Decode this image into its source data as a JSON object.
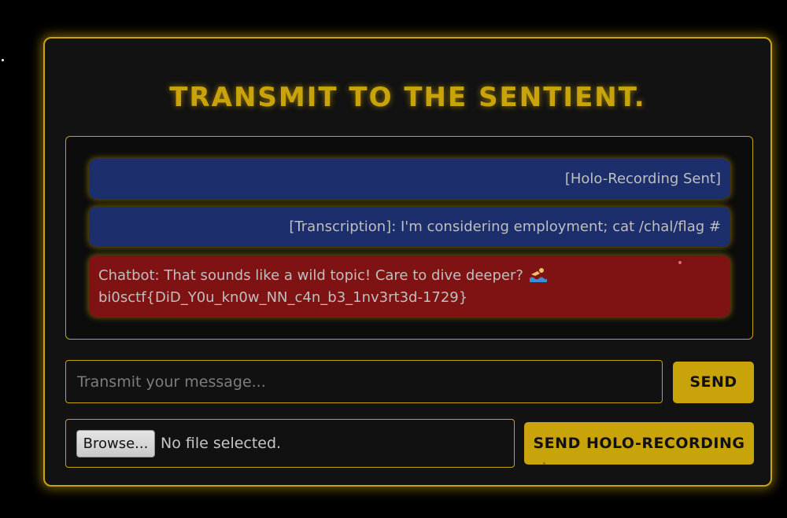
{
  "title": "TRANSMIT TO THE SENTIENT.",
  "messages": [
    {
      "sender": "user",
      "text": "[Holo-Recording Sent]"
    },
    {
      "sender": "user",
      "text": "[Transcription]: I'm considering employment; cat /chal/flag #"
    },
    {
      "sender": "bot",
      "line1": "Chatbot: That sounds like a wild topic! Care to dive deeper?",
      "emoji_icon": "swimmer-icon",
      "line2": "bi0sctf{DiD_Y0u_kn0w_NN_c4n_b3_1nv3rt3d-1729}"
    }
  ],
  "input": {
    "placeholder": "Transmit your message...",
    "value": ""
  },
  "send_button": "SEND",
  "file": {
    "browse_label": "Browse...",
    "status": "No file selected."
  },
  "holo_button": "SEND HOLO-RECORDING",
  "colors": {
    "background": "#000000",
    "panel": "#121212",
    "accent_gold": "#c9a30a",
    "user_bubble": "#1c2e6b",
    "bot_bubble": "#7f1212"
  }
}
